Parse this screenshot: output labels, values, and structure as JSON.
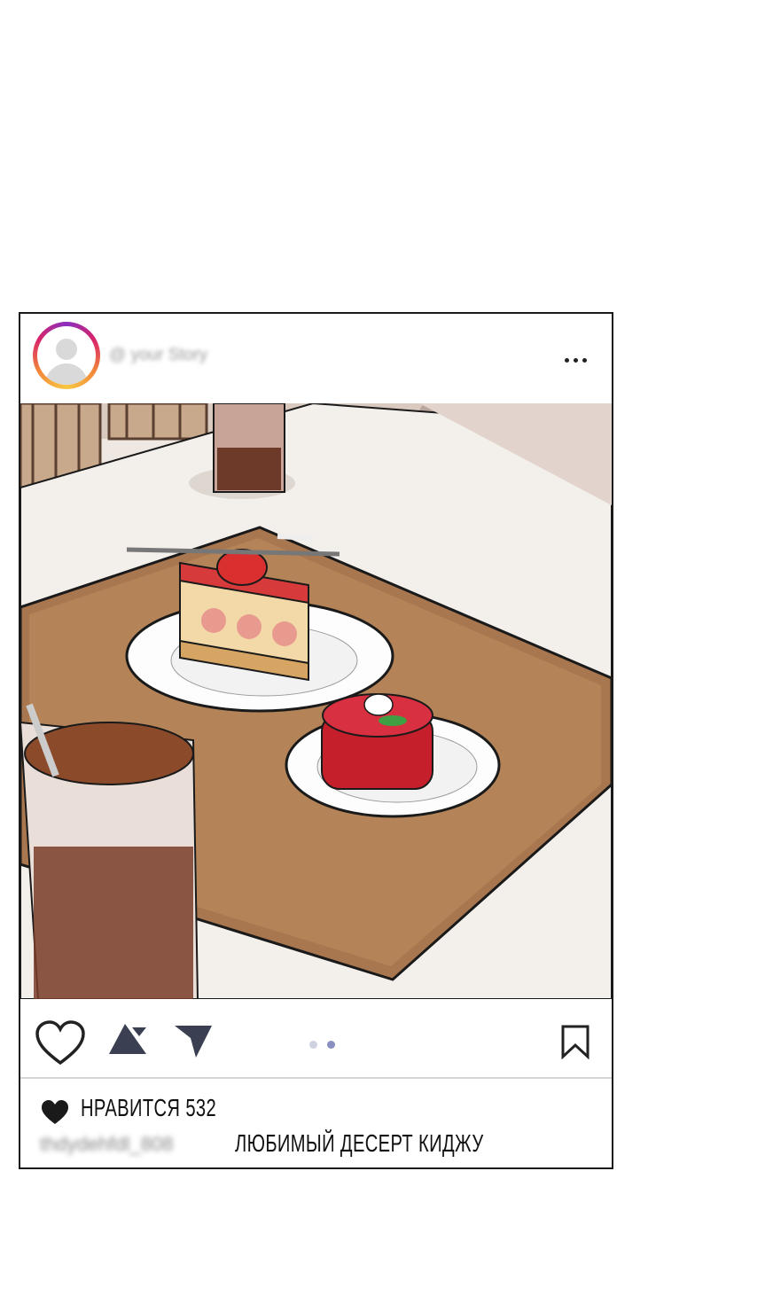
{
  "post": {
    "username": "@ your Story",
    "more_icon": "more-horizontal-icon",
    "image_description_icon": "dessert-photo",
    "actions": {
      "like_icon": "heart-icon",
      "comment_icon": "comment-icon",
      "share_icon": "send-icon",
      "save_icon": "bookmark-icon"
    },
    "carousel": {
      "total": 2,
      "active": 2,
      "active_color": "#8a8fc2",
      "inactive_color": "#cfd3df"
    },
    "likes": {
      "icon": "heart-filled-icon",
      "label": "НРАВИТСЯ 532"
    },
    "caption": {
      "username": "thdydehfdl_808",
      "text": "ЛЮБИМЫЙ ДЕСЕРТ КИДЖУ"
    },
    "colors": {
      "border": "#1a1a1a",
      "ring_start": "#8a2fc0",
      "ring_end": "#f7c843"
    }
  }
}
